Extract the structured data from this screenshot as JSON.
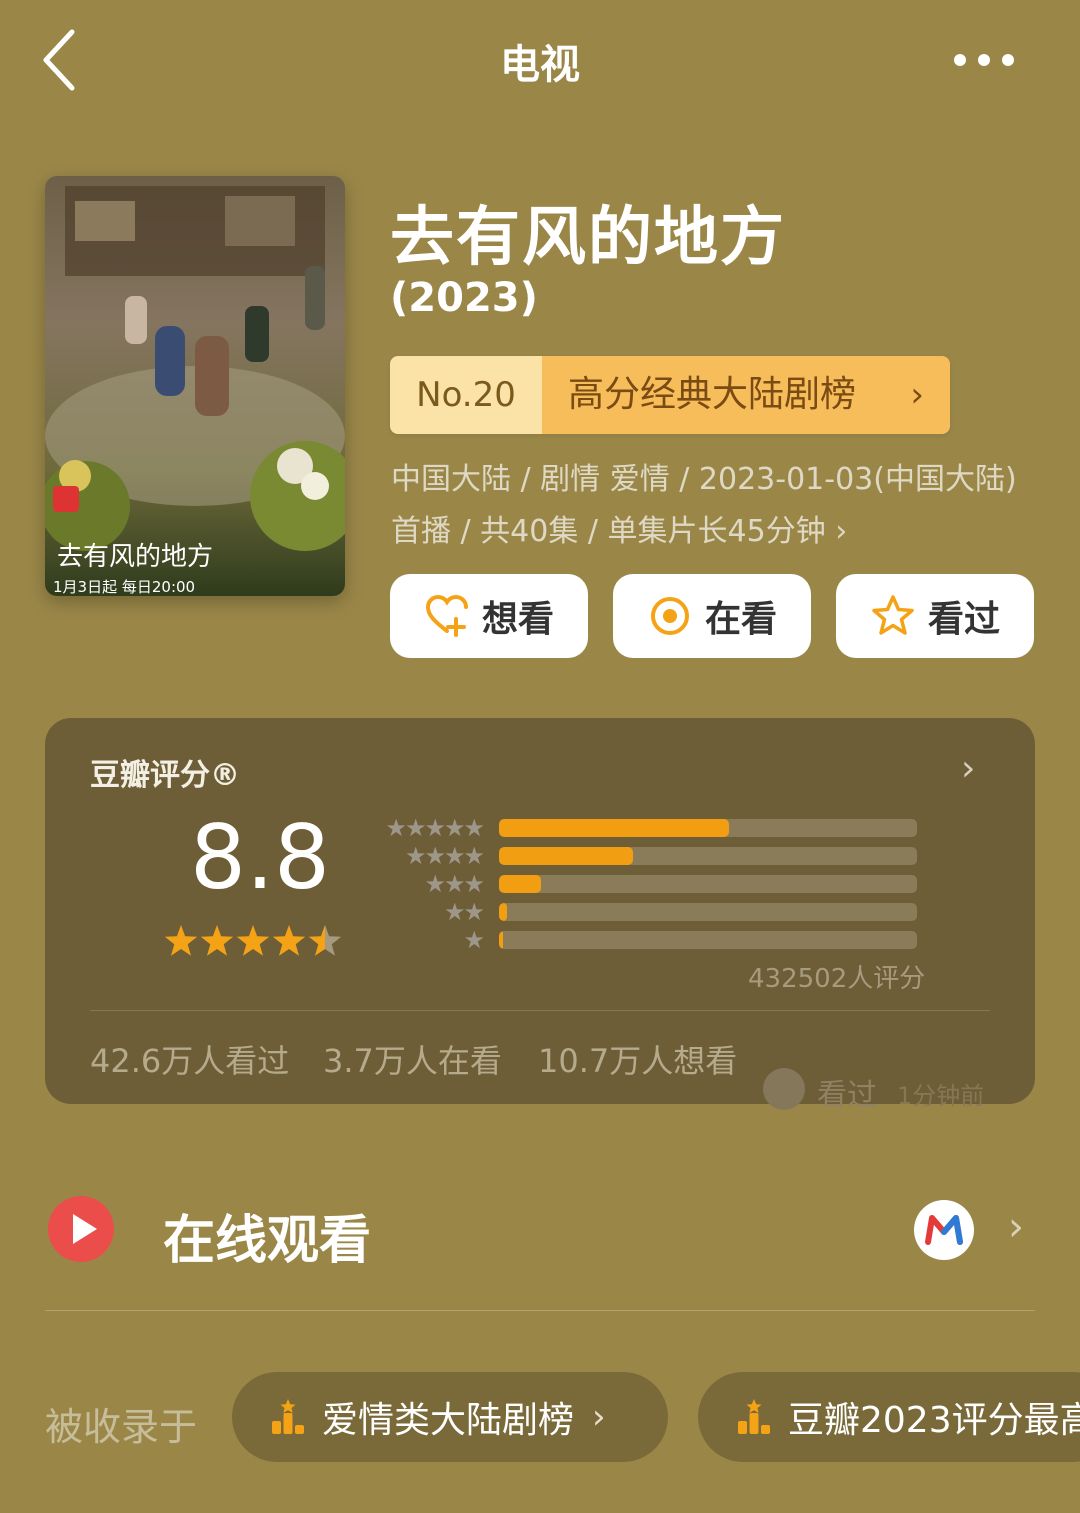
{
  "header": {
    "title": "电视"
  },
  "poster": {
    "caption": "去有风的地方",
    "air_info": "1月3日起 每日20:00"
  },
  "show": {
    "title": "去有风的地方",
    "year": "(2023)",
    "rank": {
      "number": "No.20",
      "list_name": "高分经典大陆剧榜",
      "chevron": "›"
    },
    "meta": "中国大陆 / 剧情 爱情 / 2023-01-03(中国大陆)首播 / 共40集 / 单集片长45分钟 ›"
  },
  "actions": {
    "want": "想看",
    "watching": "在看",
    "watched": "看过"
  },
  "rating": {
    "label": "豆瓣评分®",
    "score": "8.8",
    "stars_value": 4.5,
    "distribution": [
      {
        "stars": "★★★★★",
        "percent": 55
      },
      {
        "stars": "★★★★",
        "percent": 32
      },
      {
        "stars": "★★★",
        "percent": 10
      },
      {
        "stars": "★★",
        "percent": 2
      },
      {
        "stars": "★",
        "percent": 1
      }
    ],
    "raters": "432502人评分",
    "stats": {
      "watched": "42.6万人看过",
      "watching": "3.7万人在看",
      "want": "10.7万人想看"
    },
    "recent": {
      "action": "看过",
      "time": "1分钟前"
    },
    "colors": {
      "bar": "#f29e12",
      "star": "#f5a316"
    }
  },
  "online": {
    "label": "在线观看",
    "platform_icon": "mango-tv-logo"
  },
  "collections": {
    "label": "被收录于",
    "items": [
      {
        "name": "爱情类大陆剧榜",
        "chevron": "›"
      },
      {
        "name": "豆瓣2023评分最高"
      }
    ]
  }
}
